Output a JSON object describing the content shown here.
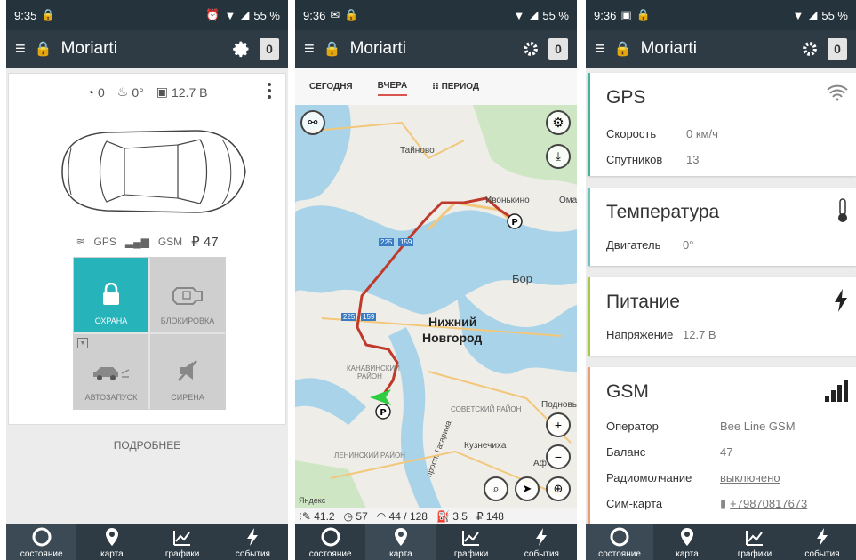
{
  "screens": [
    {
      "status": {
        "time": "9:35",
        "battery": "55 %"
      },
      "appbar": {
        "title": "Moriarti",
        "counter": "0"
      }
    },
    {
      "status": {
        "time": "9:36",
        "battery": "55 %"
      },
      "appbar": {
        "title": "Moriarti",
        "counter": "0"
      }
    },
    {
      "status": {
        "time": "9:36",
        "battery": "55 %"
      },
      "appbar": {
        "title": "Moriarti",
        "counter": "0"
      }
    }
  ],
  "state": {
    "speed": "0",
    "temp": "0°",
    "voltage": "12.7 В",
    "gps_label": "GPS",
    "gsm_label": "GSM",
    "balance": "₽ 47",
    "tiles": [
      {
        "label": "ОХРАНА"
      },
      {
        "label": "БЛОКИРОВКА"
      },
      {
        "label": "АВТОЗАПУСК"
      },
      {
        "label": "СИРЕНА"
      }
    ],
    "more": "ПОДРОБНЕЕ"
  },
  "map": {
    "tabs": [
      "СЕГОДНЯ",
      "ВЧЕРА",
      "ПЕРИОД"
    ],
    "labels": {
      "tainovo": "Тайново",
      "ivonkino": "Ивонькино",
      "oma": "Ома",
      "bor": "Бор",
      "nn1": "Нижний",
      "nn2": "Новгород",
      "kanav": "КАНАВИНСКИЙ",
      "rai": "РАЙОН",
      "sov": "СОВЕТСКИЙ РАЙОН",
      "podn": "Подновь",
      "kuzn": "Кузнечиха",
      "len": "ЛЕНИНСКИЙ РАЙОН",
      "gag": "просп. Гагарина",
      "af": "Аф",
      "yandex": "Яндекс",
      "r225a": "225",
      "r159a": "159",
      "r225b": "225",
      "r159b": "159"
    },
    "info": {
      "dist": "41.2",
      "time": "57",
      "speed": "44 / 128",
      "fuel": "3.5",
      "cost": "₽ 148"
    }
  },
  "info": {
    "gps": {
      "title": "GPS",
      "speed_k": "Скорость",
      "speed_v": "0 км/ч",
      "sat_k": "Спутников",
      "sat_v": "13"
    },
    "temp": {
      "title": "Температура",
      "eng_k": "Двигатель",
      "eng_v": "0°"
    },
    "power": {
      "title": "Питание",
      "volt_k": "Напряжение",
      "volt_v": "12.7 В"
    },
    "gsm": {
      "title": "GSM",
      "op_k": "Оператор",
      "op_v": "Bee Line GSM",
      "bal_k": "Баланс",
      "bal_v": "47",
      "radio_k": "Радиомолчание",
      "radio_v": "выключено",
      "sim_k": "Сим-карта",
      "sim_v": "+79870817673"
    }
  },
  "nav": [
    "состояние",
    "карта",
    "графики",
    "события"
  ],
  "colors": {
    "accent": "#26b3ba",
    "route": "#c0392b",
    "appbar": "#2e3b44"
  }
}
